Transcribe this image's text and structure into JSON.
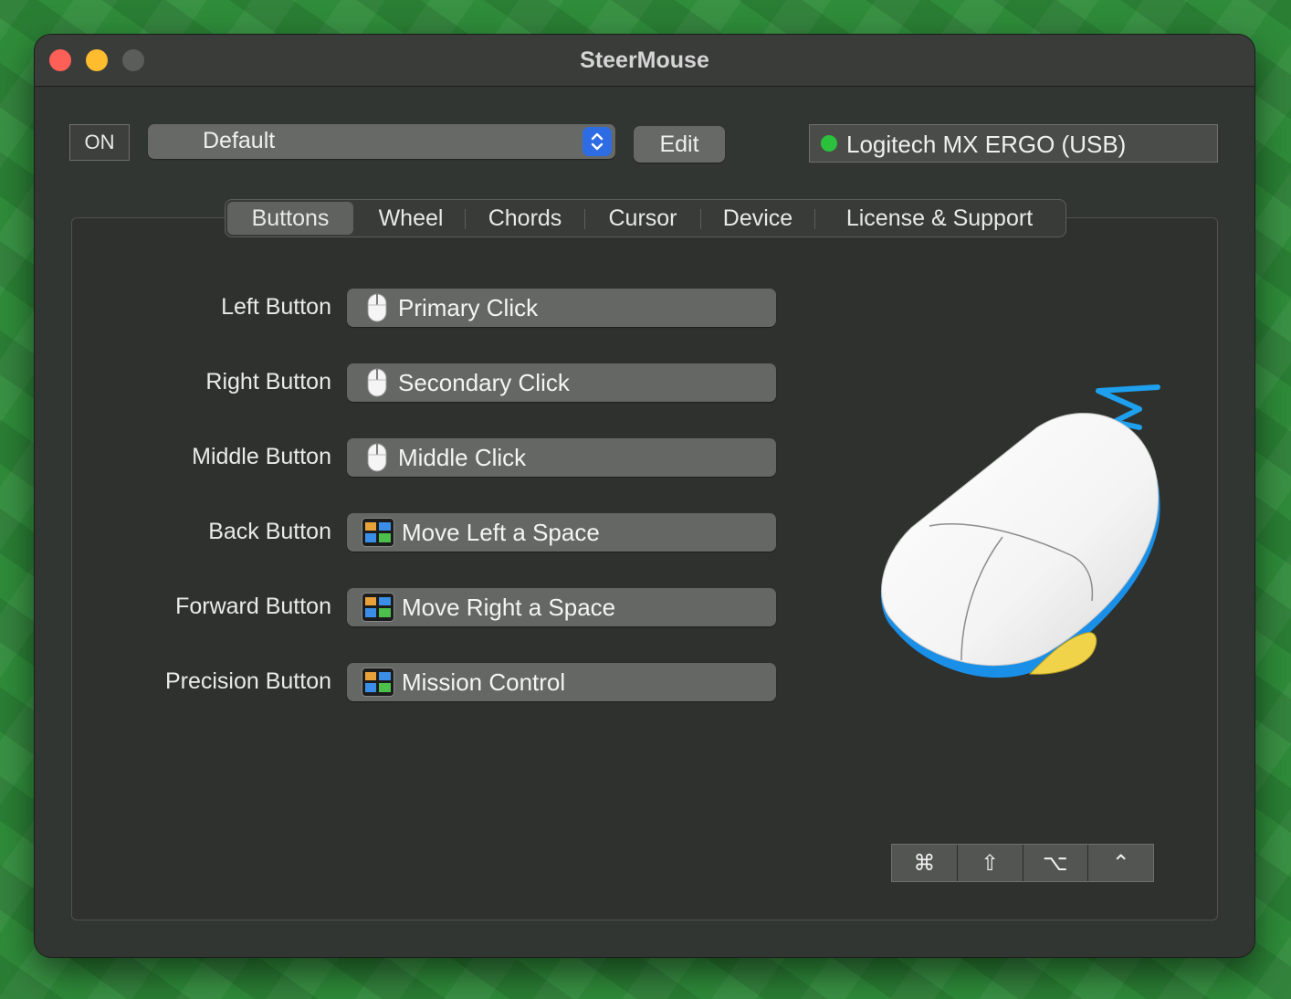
{
  "window": {
    "title": "SteerMouse"
  },
  "toolbar": {
    "on_label": "ON",
    "preset_value": "Default",
    "edit_label": "Edit",
    "device_name": "Logitech MX ERGO (USB)",
    "device_status_color": "#2bc13c"
  },
  "tabs": [
    {
      "label": "Buttons",
      "active": true
    },
    {
      "label": "Wheel",
      "active": false
    },
    {
      "label": "Chords",
      "active": false
    },
    {
      "label": "Cursor",
      "active": false
    },
    {
      "label": "Device",
      "active": false
    },
    {
      "label": "License & Support",
      "active": false
    }
  ],
  "button_rows": [
    {
      "label": "Left Button",
      "action": "Primary Click",
      "icon": "mouse-icon"
    },
    {
      "label": "Right Button",
      "action": "Secondary Click",
      "icon": "mouse-icon"
    },
    {
      "label": "Middle Button",
      "action": "Middle Click",
      "icon": "mouse-icon"
    },
    {
      "label": "Back Button",
      "action": "Move Left a Space",
      "icon": "mission-control-icon"
    },
    {
      "label": "Forward Button",
      "action": "Move Right a Space",
      "icon": "mission-control-icon"
    },
    {
      "label": "Precision Button",
      "action": "Mission Control",
      "icon": "mission-control-icon"
    }
  ],
  "modifiers": [
    {
      "symbol": "⌘",
      "name": "command-key"
    },
    {
      "symbol": "⇧",
      "name": "shift-key"
    },
    {
      "symbol": "⌥",
      "name": "option-key"
    },
    {
      "symbol": "⌃",
      "name": "control-key"
    }
  ]
}
